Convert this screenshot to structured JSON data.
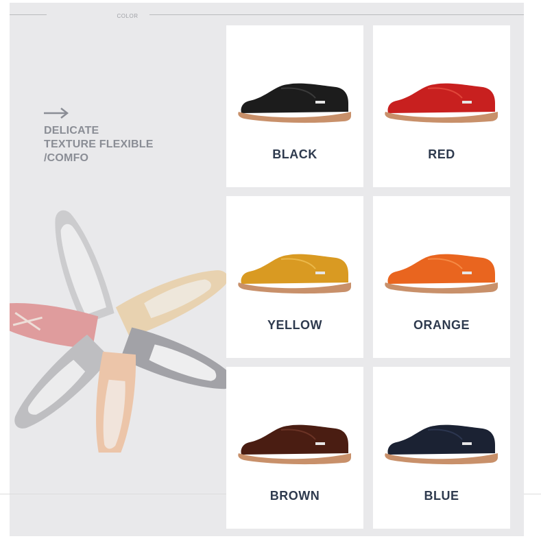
{
  "header": {
    "section_label": "COLOR"
  },
  "tagline": [
    "DELICATE",
    "TEXTURE FLEXIBLE",
    "/COMFO"
  ],
  "variants": [
    {
      "label": "BLACK",
      "upper": "#1c1c1c",
      "upper_light": "#3a3a3a"
    },
    {
      "label": "RED",
      "upper": "#c8201f",
      "upper_light": "#e0463a"
    },
    {
      "label": "YELLOW",
      "upper": "#d99a22",
      "upper_light": "#ebb84a"
    },
    {
      "label": "ORANGE",
      "upper": "#e9651f",
      "upper_light": "#f58a45"
    },
    {
      "label": "BROWN",
      "upper": "#4a1d12",
      "upper_light": "#6b3325"
    },
    {
      "label": "BLUE",
      "upper": "#1b2233",
      "upper_light": "#2c3650"
    }
  ],
  "colors": {
    "sole": "#c8906a",
    "sole_dark": "#a86f4c",
    "label_text": "#2e3a4e",
    "tagline_text": "#8a8d95"
  }
}
